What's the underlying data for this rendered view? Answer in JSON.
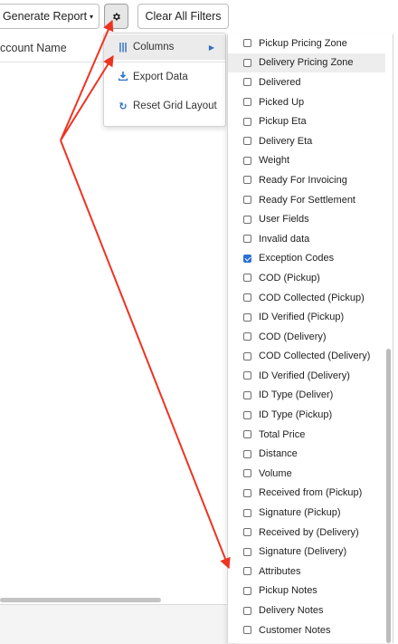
{
  "toolbar": {
    "generate_report_label": "Generate Report",
    "generate_report_caret": "▾",
    "settings_icon": "gear-icon",
    "clear_filters_label": "Clear All Filters"
  },
  "grid": {
    "column_header": "ccount Name"
  },
  "settings_menu": {
    "items": [
      {
        "label": "Columns",
        "icon": "columns-icon",
        "has_submenu": true
      },
      {
        "label": "Export Data",
        "icon": "download-icon"
      },
      {
        "label": "Reset Grid Layout",
        "icon": "refresh-icon"
      }
    ]
  },
  "columns_panel": {
    "items": [
      {
        "label": "Pickup Pricing Zone",
        "checked": false
      },
      {
        "label": "Delivery Pricing Zone",
        "checked": false,
        "hover": true
      },
      {
        "label": "Delivered",
        "checked": false
      },
      {
        "label": "Picked Up",
        "checked": false
      },
      {
        "label": "Pickup Eta",
        "checked": false
      },
      {
        "label": "Delivery Eta",
        "checked": false
      },
      {
        "label": "Weight",
        "checked": false
      },
      {
        "label": "Ready For Invoicing",
        "checked": false
      },
      {
        "label": "Ready For Settlement",
        "checked": false
      },
      {
        "label": "User Fields",
        "checked": false
      },
      {
        "label": "Invalid data",
        "checked": false
      },
      {
        "label": "Exception Codes",
        "checked": true
      },
      {
        "label": "COD (Pickup)",
        "checked": false
      },
      {
        "label": "COD Collected (Pickup)",
        "checked": false
      },
      {
        "label": "ID Verified (Pickup)",
        "checked": false
      },
      {
        "label": "COD (Delivery)",
        "checked": false
      },
      {
        "label": "COD Collected (Delivery)",
        "checked": false
      },
      {
        "label": "ID Verified (Delivery)",
        "checked": false
      },
      {
        "label": "ID Type (Deliver)",
        "checked": false
      },
      {
        "label": "ID Type (Pickup)",
        "checked": false
      },
      {
        "label": "Total Price",
        "checked": false
      },
      {
        "label": "Distance",
        "checked": false
      },
      {
        "label": "Volume",
        "checked": false
      },
      {
        "label": "Received from (Pickup)",
        "checked": false
      },
      {
        "label": "Signature (Pickup)",
        "checked": false
      },
      {
        "label": "Received by (Delivery)",
        "checked": false
      },
      {
        "label": "Signature (Delivery)",
        "checked": false
      },
      {
        "label": "Attributes",
        "checked": false
      },
      {
        "label": "Pickup Notes",
        "checked": false
      },
      {
        "label": "Delivery Notes",
        "checked": false
      },
      {
        "label": "Customer Notes",
        "checked": false
      }
    ]
  },
  "annotation": {
    "arrow_color": "#ee3322"
  }
}
